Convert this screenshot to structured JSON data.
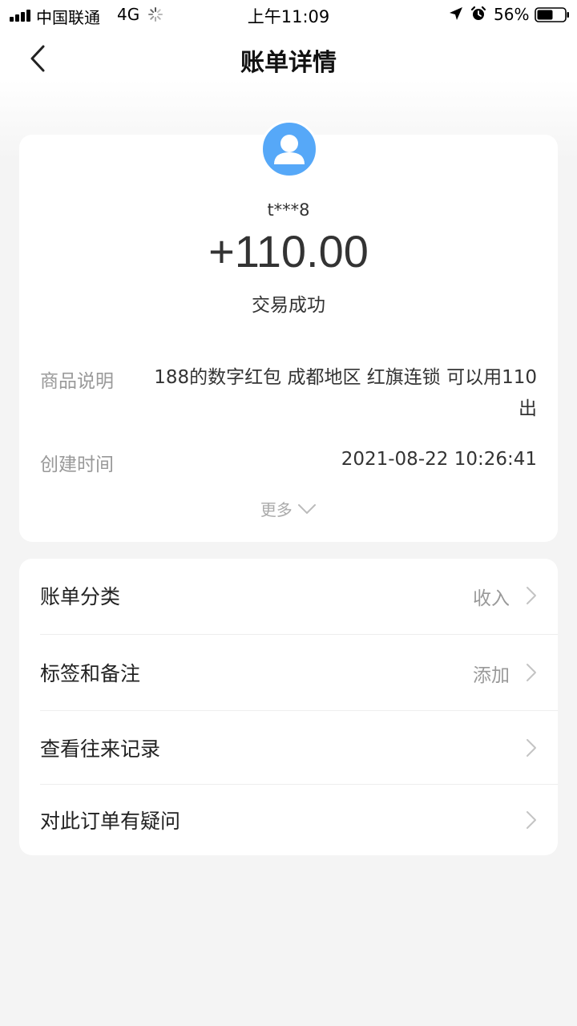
{
  "status_bar": {
    "carrier": "中国联通",
    "network": "4G",
    "time": "上午11:09",
    "battery": "56%"
  },
  "nav": {
    "title": "账单详情",
    "back_icon": "chevron-left-icon"
  },
  "transaction": {
    "username": "t***8",
    "amount": "+110.00",
    "status": "交易成功",
    "avatar_icon": "user-avatar-icon",
    "avatar_color": "#56a8f8"
  },
  "details": {
    "description_label": "商品说明",
    "description_value": "188的数字红包 成都地区 红旗连锁 可以用110出",
    "created_label": "创建时间",
    "created_value": "2021-08-22 10:26:41",
    "more_label": "更多"
  },
  "menu": [
    {
      "label": "账单分类",
      "value": "收入"
    },
    {
      "label": "标签和备注",
      "value": "添加"
    },
    {
      "label": "查看往来记录",
      "value": ""
    },
    {
      "label": "对此订单有疑问",
      "value": ""
    }
  ]
}
